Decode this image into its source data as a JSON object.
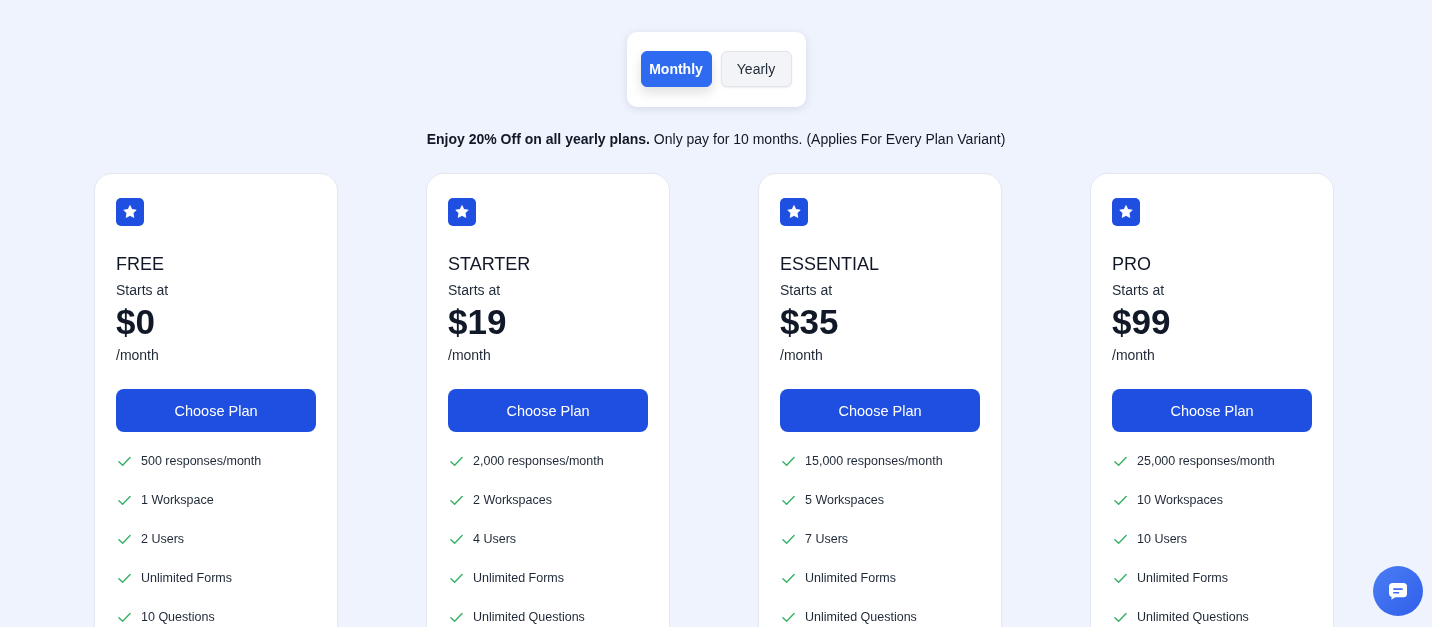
{
  "billing_toggle": {
    "options": [
      {
        "label": "Monthly",
        "selected": true
      },
      {
        "label": "Yearly",
        "selected": false
      }
    ]
  },
  "promo": "**Enjoy 20% Off on all yearly plans.** Only pay for 10 months. (Applies For Every Plan Variant)",
  "plans": [
    {
      "name": "FREE",
      "starts_label": "Starts at",
      "price": "$0",
      "period": "/month",
      "button": "Choose Plan",
      "features": [
        "500 responses/month",
        "1 Workspace",
        "2 Users",
        "Unlimited Forms",
        "10 Questions"
      ]
    },
    {
      "name": "STARTER",
      "starts_label": "Starts at",
      "price": "$19",
      "period": "/month",
      "button": "Choose Plan",
      "features": [
        "2,000 responses/month",
        "2 Workspaces",
        "4 Users",
        "Unlimited Forms",
        "Unlimited Questions"
      ]
    },
    {
      "name": "ESSENTIAL",
      "starts_label": "Starts at",
      "price": "$35",
      "period": "/month",
      "button": "Choose Plan",
      "features": [
        "15,000 responses/month",
        "5 Workspaces",
        "7 Users",
        "Unlimited Forms",
        "Unlimited Questions"
      ]
    },
    {
      "name": "PRO",
      "starts_label": "Starts at",
      "price": "$99",
      "period": "/month",
      "button": "Choose Plan",
      "features": [
        "25,000 responses/month",
        "10 Workspaces",
        "10 Users",
        "Unlimited Forms",
        "Unlimited Questions"
      ]
    }
  ]
}
